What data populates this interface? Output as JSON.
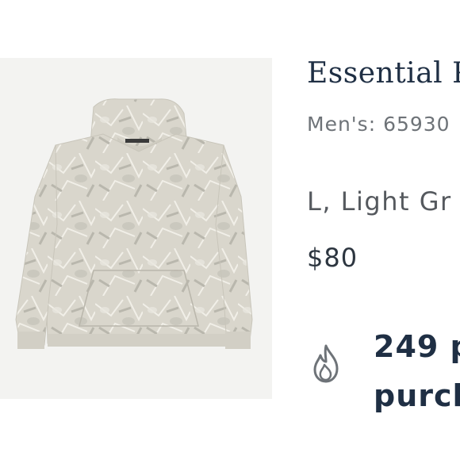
{
  "product": {
    "name": "Essential P",
    "sku": "Men's: 65930",
    "variant": "L, Light Gr",
    "price": "$80"
  },
  "purchases": {
    "line1": "249 p",
    "line2": "purch",
    "icon": "flame-icon"
  },
  "image": {
    "subject": "hoodie",
    "background_color": "#f3f3f1",
    "garment_color": "#d9d6cc"
  }
}
